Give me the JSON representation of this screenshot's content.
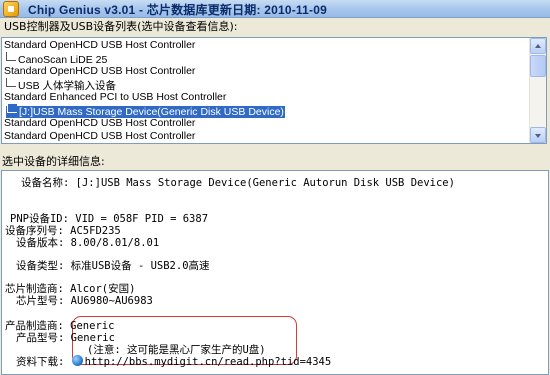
{
  "window": {
    "title": "Chip Genius v3.01 - 芯片数据库更新日期: 2010-11-09"
  },
  "device_list": {
    "label": "USB控制器及USB设备列表(选中设备查看信息):",
    "items": [
      {
        "label": "Standard OpenHCD USB Host Controller",
        "child": false,
        "selected": false
      },
      {
        "label": "CanoScan LiDE 25",
        "child": true,
        "selected": false
      },
      {
        "label": "Standard OpenHCD USB Host Controller",
        "child": false,
        "selected": false
      },
      {
        "label": "USB 人体学输入设备",
        "child": true,
        "selected": false
      },
      {
        "label": "Standard Enhanced PCI to USB Host Controller",
        "child": false,
        "selected": false
      },
      {
        "label": "[J:]USB Mass Storage Device(Generic Disk USB Device)",
        "child": true,
        "selected": true
      },
      {
        "label": "Standard OpenHCD USB Host Controller",
        "child": false,
        "selected": false
      },
      {
        "label": "Standard OpenHCD USB Host Controller",
        "child": false,
        "selected": false
      }
    ]
  },
  "details": {
    "label": "选中设备的详细信息:",
    "device_name": {
      "key": "设备名称:",
      "value": "[J:]USB Mass Storage Device(Generic Autorun Disk USB Device)"
    },
    "pnp_id": {
      "key": "PNP设备ID:",
      "value": "VID = 058F PID = 6387"
    },
    "serial": {
      "key": "设备序列号:",
      "value": "AC5FD235"
    },
    "version": {
      "key": "设备版本:",
      "value": "8.00/8.01/8.01"
    },
    "type": {
      "key": "设备类型:",
      "value": "标准USB设备 - USB2.0高速"
    },
    "chip_vendor": {
      "key": "芯片制造商:",
      "value": "Alcor(安国)"
    },
    "chip_model": {
      "key": "芯片型号:",
      "value": "AU6980~AU6983"
    },
    "product_vendor": {
      "key": "产品制造商:",
      "value": "Generic"
    },
    "product_model": {
      "key": "产品型号:",
      "value": "Generic"
    },
    "note": "(注意: 这可能是黑心厂家生产的U盘)",
    "download": {
      "key": "资料下载:",
      "value": "http://bbs.mydigit.cn/read.php?tid=4345"
    }
  }
}
